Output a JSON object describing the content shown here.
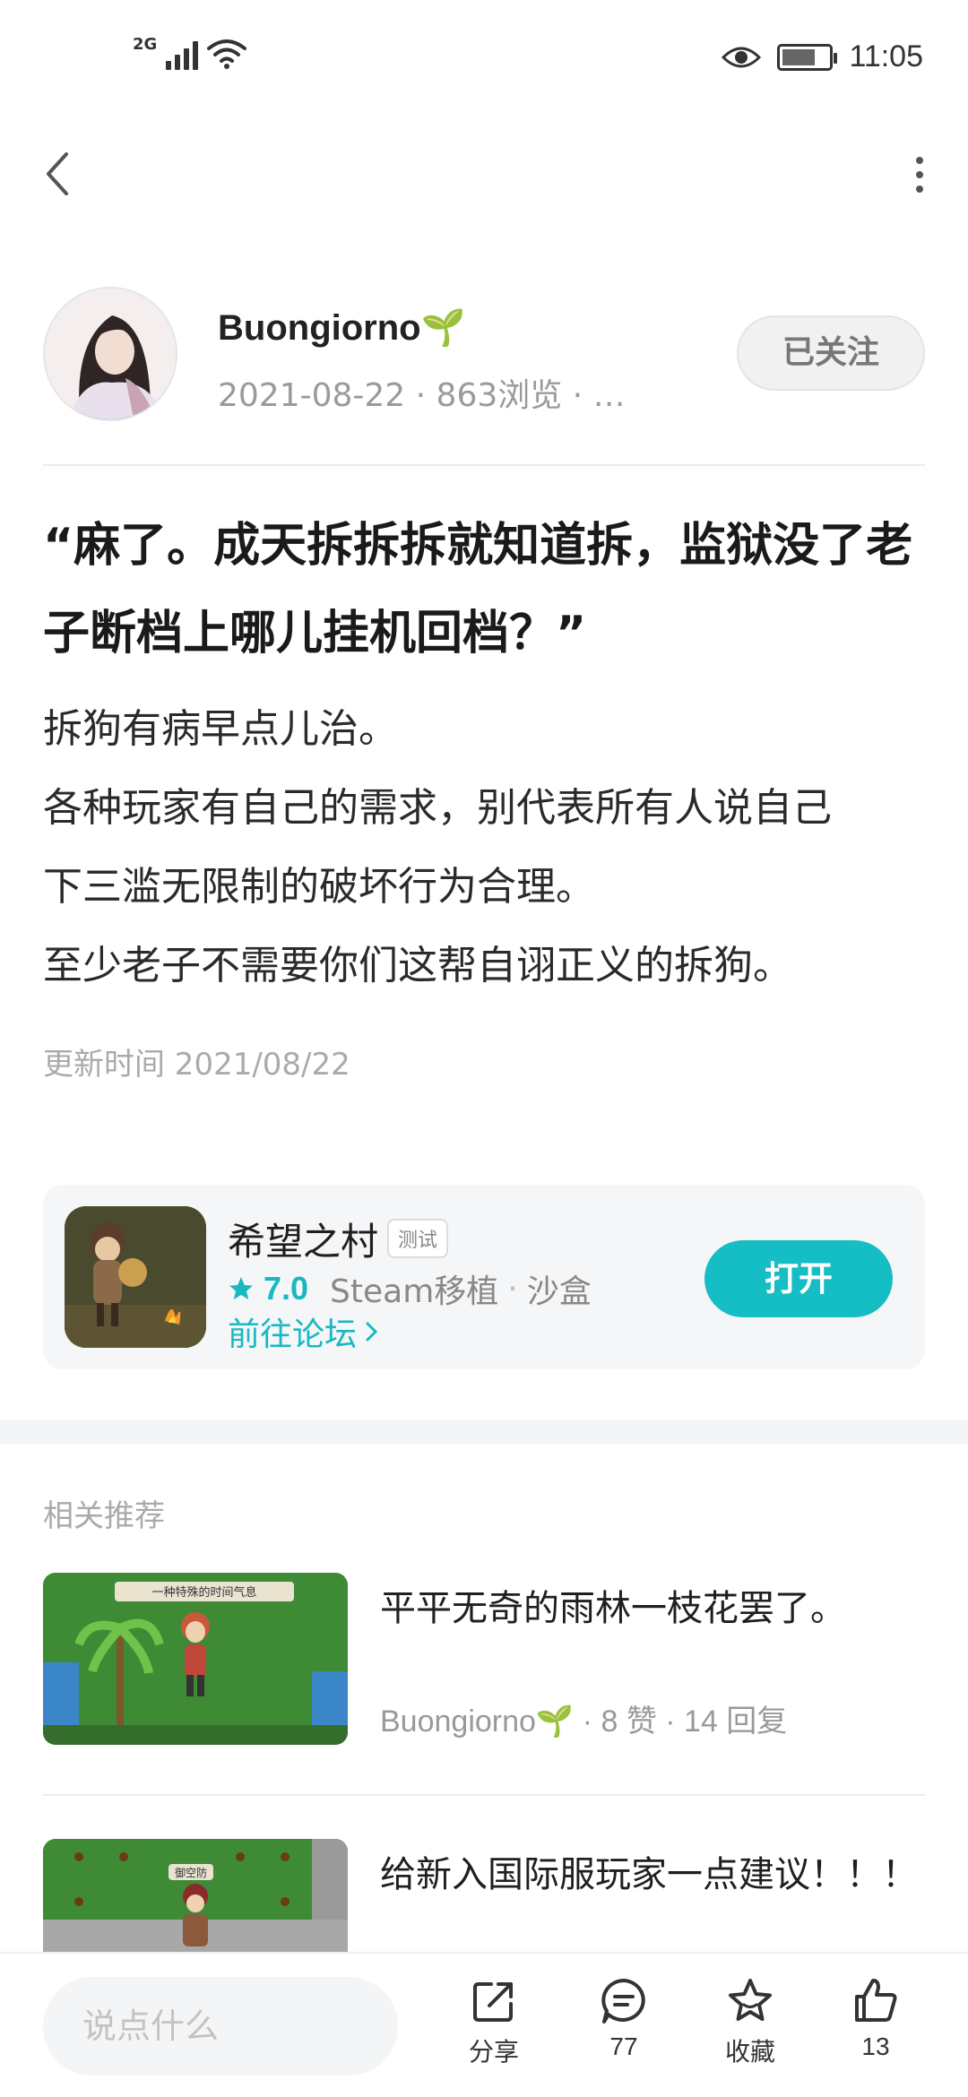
{
  "status_bar": {
    "network": "2G",
    "time": "11:05"
  },
  "author": {
    "name": "Buongiorno🌱",
    "meta": "2021-08-22 · 863浏览 · …",
    "follow_label": "已关注"
  },
  "post": {
    "title": "“麻了。成天拆拆拆就知道拆，监狱没了老子断档上哪儿挂机回档？”",
    "body_lines": [
      "拆狗有病早点儿治。",
      "各种玩家有自己的需求，别代表所有人说自己",
      "下三滥无限制的破坏行为合理。",
      "至少老子不需要你们这帮自诩正义的拆狗。"
    ],
    "updated": "更新时间 2021/08/22"
  },
  "game_card": {
    "name": "希望之村",
    "tag": "测试",
    "rating": "7.0",
    "category_1": "Steam移植",
    "category_2": "沙盒",
    "forum_link": "前往论坛",
    "open_label": "打开"
  },
  "related": {
    "section_title": "相关推荐",
    "items": [
      {
        "headline": "平平无奇的雨林一枝花罢了。",
        "meta": "Buongiorno🌱 · 8 赞 · 14 回复",
        "thumb_caption": "一种特殊的时间气息"
      },
      {
        "headline": "给新入国际服玩家一点建议！！！",
        "meta": "",
        "thumb_caption": "御空防"
      }
    ]
  },
  "bottom_bar": {
    "comment_placeholder": "说点什么",
    "share_label": "分享",
    "comment_count": "77",
    "favorite_label": "收藏",
    "like_count": "13"
  },
  "colors": {
    "accent": "#15bdc4",
    "text_primary": "#1a1a1a",
    "text_secondary": "#999999",
    "card_bg": "#f5f6f8"
  }
}
